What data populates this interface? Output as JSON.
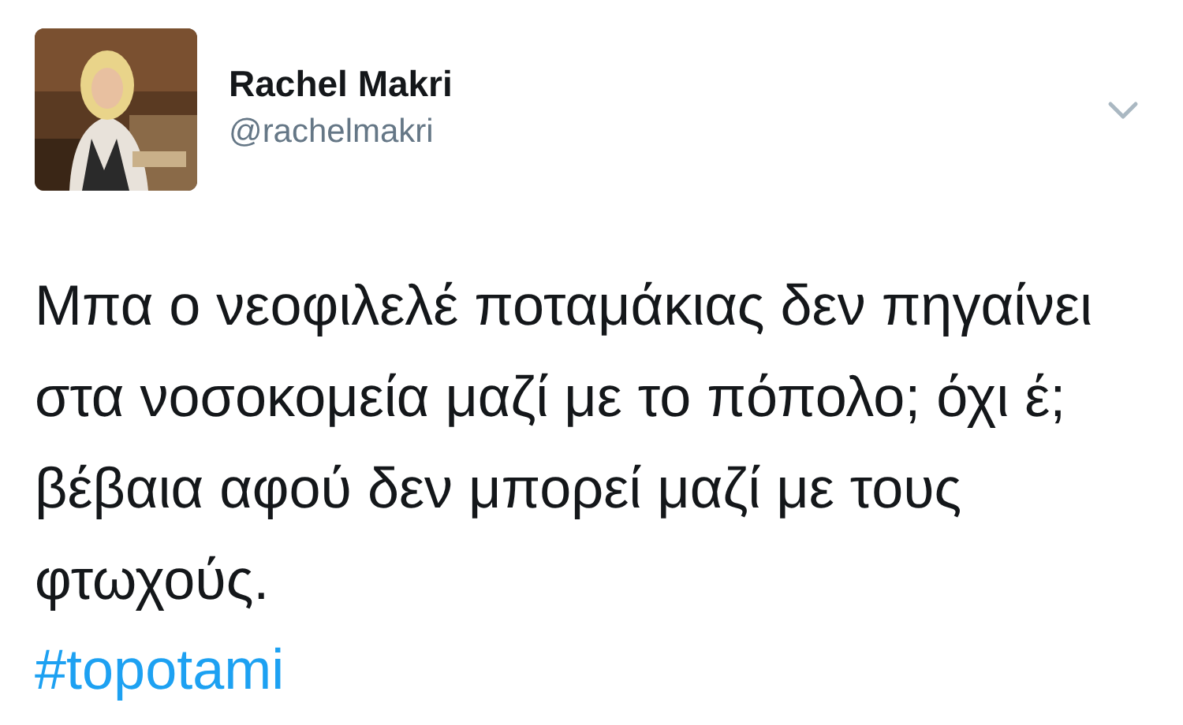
{
  "tweet": {
    "author": {
      "name": "Rachel Makri",
      "handle": "@rachelmakri"
    },
    "text": "Μπα ο νεοφιλελέ ποταμάκιας δεν πηγαίνει στα νοσοκομεία μαζί με το πόπολο; όχι έ; βέβαια αφού δεν μπορεί μαζί με τους φτωχούς.",
    "hashtag": "#topotami"
  }
}
